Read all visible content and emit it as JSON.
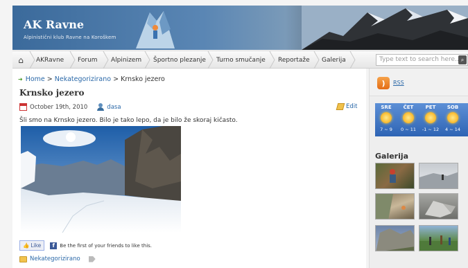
{
  "header": {
    "title": "AK Ravne",
    "subtitle": "Alpinistični klub Ravne na Koroškem"
  },
  "nav": {
    "home_icon": "home-icon",
    "items": [
      {
        "label": "AKRavne"
      },
      {
        "label": "Forum"
      },
      {
        "label": "Alpinizem"
      },
      {
        "label": "Športno plezanje"
      },
      {
        "label": "Turno smučanje"
      },
      {
        "label": "Reportaže"
      },
      {
        "label": "Galerija"
      }
    ],
    "search_placeholder": "Type text to search here..."
  },
  "breadcrumb": {
    "home": "Home",
    "sep1": ">",
    "category": "Nekategorizirano",
    "sep2": ">",
    "current": "Krnsko jezero"
  },
  "post": {
    "title": "Krnsko jezero",
    "date": "October 19th, 2010",
    "author": "dasa",
    "edit_label": "Edit",
    "text": "Šli smo na Krnsko jezero. Bilo je tako lepo, da je bilo že skoraj kičasto.",
    "like_label": "Like",
    "fb_text": "Be the first of your friends to like this.",
    "category_label": "Nekategorizirano"
  },
  "sidebar": {
    "rss_label": "RSS",
    "weather": [
      {
        "day": "SRE",
        "temp": "7 ~ 9"
      },
      {
        "day": "ČET",
        "temp": "0 ~ 11"
      },
      {
        "day": "PET",
        "temp": "-1 ~ 12"
      },
      {
        "day": "SOB",
        "temp": "4 ~ 14"
      }
    ],
    "gallery_title": "Galerija"
  },
  "colors": {
    "link": "#2a68a8",
    "header_blue": "#2f5f8f",
    "weather_blue": "#2e64b4"
  }
}
